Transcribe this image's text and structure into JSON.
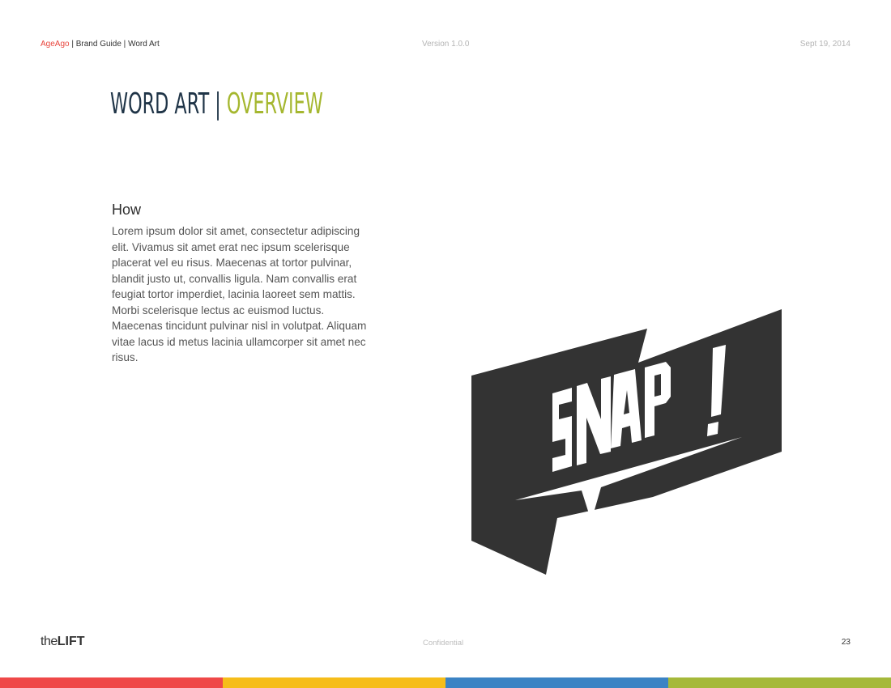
{
  "header": {
    "brand": "AgeAgo",
    "separator": " | ",
    "guide": "Brand Guide",
    "section": "Word Art",
    "version": "Version 1.0.0",
    "date": "Sept 19, 2014"
  },
  "title": {
    "part1": "WORD ART",
    "divider": " | ",
    "part2": "OVERVIEW"
  },
  "content": {
    "heading": "How",
    "paragraph": "Lorem ipsum dolor sit amet, consectetur adipiscing elit. Vivamus sit amet erat nec ipsum scelerisque placerat vel eu risus. Maecenas at tortor pulvinar, blandit justo ut, convallis ligula. Nam convallis erat feugiat tortor imperdiet, lacinia laoreet sem mattis. Morbi scelerisque lectus ac euismod luctus. Maecenas tincidunt pulvinar nisl in volutpat. Aliquam vitae lacus id metus lacinia ullamcorper sit amet nec risus."
  },
  "artwork": {
    "word": "SNAP!",
    "fill_color": "#333333"
  },
  "footer": {
    "logo_light": "the",
    "logo_bold": "LIFT",
    "confidential": "Confidential",
    "page_number": "23"
  },
  "color_bar": [
    "#ef4848",
    "#f6bd1a",
    "#3b83c4",
    "#a5b93a"
  ],
  "colors": {
    "brand_red": "#e8453c",
    "title_navy": "#1f3447",
    "title_green": "#a5b72f"
  }
}
